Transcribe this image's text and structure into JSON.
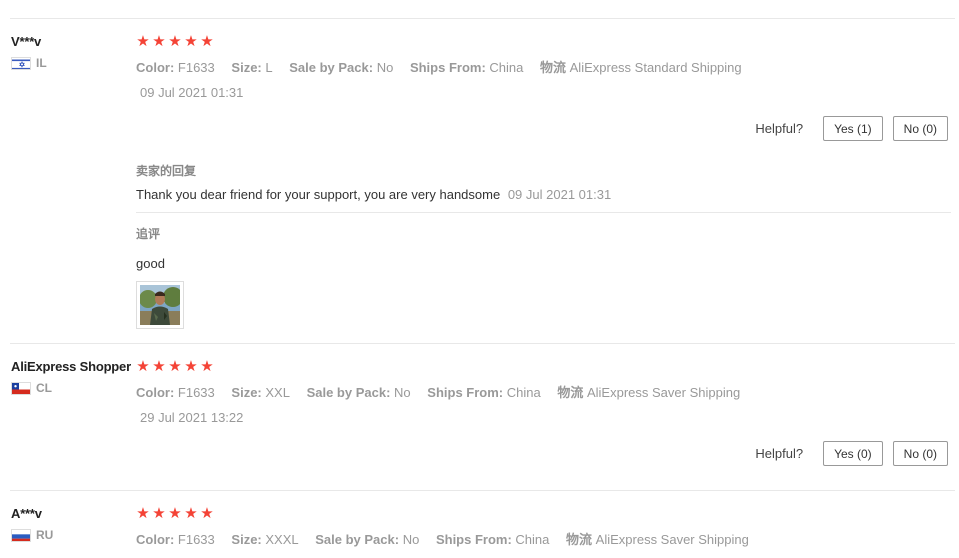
{
  "labels": {
    "color": "Color:",
    "size": "Size:",
    "sale_by_pack": "Sale by Pack:",
    "ships_from": "Ships From:",
    "logistics": "物流",
    "helpful": "Helpful?",
    "seller_reply": "卖家的回复",
    "follow_up": "追评"
  },
  "reviews": [
    {
      "user": "V***v",
      "country": "IL",
      "flag_icon": "israel-flag-icon",
      "rating": 5,
      "stars": [
        "★",
        "★",
        "★",
        "★",
        "★"
      ],
      "color": "F1633",
      "size": "L",
      "sale_by_pack": "No",
      "ships_from": "China",
      "shipping": "AliExpress Standard Shipping",
      "date": "09 Jul 2021 01:31",
      "yes_label": "Yes (1)",
      "no_label": "No (0)",
      "seller_reply": "Thank you dear friend for your support, you are very handsome",
      "seller_reply_date": "09 Jul 2021 01:31",
      "follow_up_text": "good"
    },
    {
      "user": "AliExpress Shopper",
      "country": "CL",
      "flag_icon": "chile-flag-icon",
      "rating": 5,
      "stars": [
        "★",
        "★",
        "★",
        "★",
        "★"
      ],
      "color": "F1633",
      "size": "XXL",
      "sale_by_pack": "No",
      "ships_from": "China",
      "shipping": "AliExpress Saver Shipping",
      "date": "29 Jul 2021 13:22",
      "yes_label": "Yes (0)",
      "no_label": "No (0)"
    },
    {
      "user": "A***v",
      "country": "RU",
      "flag_icon": "russia-flag-icon",
      "rating": 5,
      "stars": [
        "★",
        "★",
        "★",
        "★",
        "★"
      ],
      "color": "F1633",
      "size": "XXXL",
      "sale_by_pack": "No",
      "ships_from": "China",
      "shipping": "AliExpress Saver Shipping"
    }
  ],
  "colors": {
    "star": "#f44336",
    "muted_text": "#999999",
    "divider": "#e8e8e8"
  }
}
